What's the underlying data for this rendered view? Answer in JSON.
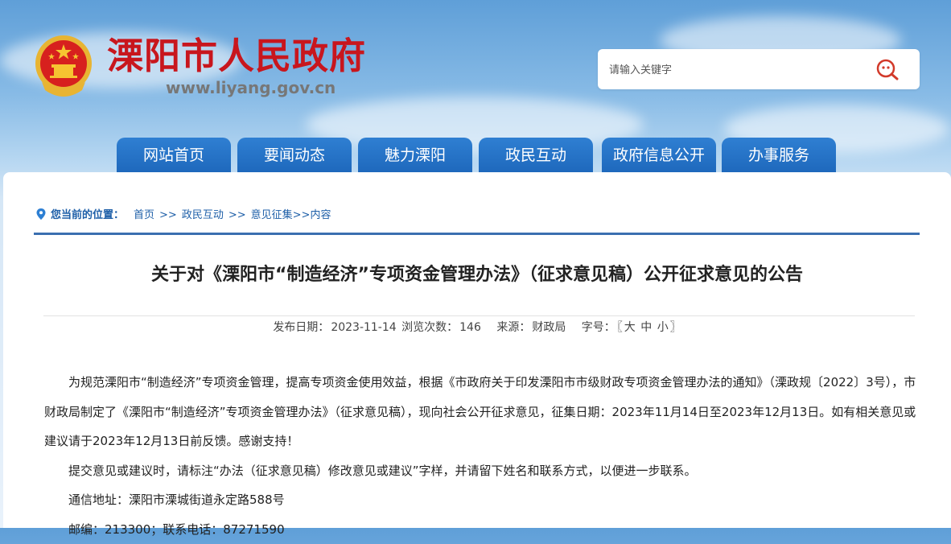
{
  "site": {
    "title": "溧阳市人民政府",
    "url": "www.liyang.gov.cn"
  },
  "search": {
    "placeholder": "请输入关键字",
    "icon": "search-icon"
  },
  "nav": {
    "items": [
      {
        "label": "网站首页"
      },
      {
        "label": "要闻动态"
      },
      {
        "label": "魅力溧阳"
      },
      {
        "label": "政民互动"
      },
      {
        "label": "政府信息公开"
      },
      {
        "label": "办事服务"
      }
    ]
  },
  "breadcrumb": {
    "label": "您当前的位置：",
    "items": [
      "首页",
      "政民互动",
      "意见征集"
    ],
    "separator": ">>",
    "current": ">>内容"
  },
  "article": {
    "title": "关于对《溧阳市“制造经济”专项资金管理办法》（征求意见稿）公开征求意见的公告",
    "meta": {
      "date_label": "发布日期：",
      "date": "2023-11-14",
      "views_label": "浏览次数：",
      "views": "146",
      "source_label": "来源：",
      "source": "财政局",
      "size_label": "字号：",
      "size_open": "〖",
      "size_large": "大",
      "size_medium": "中",
      "size_small": "小",
      "size_close": "〗"
    },
    "paragraphs": [
      "为规范溧阳市“制造经济”专项资金管理，提高专项资金使用效益，根据《市政府关于印发溧阳市市级财政专项资金管理办法的通知》（溧政规〔2022〕3号），市财政局制定了《溧阳市“制造经济”专项资金管理办法》（征求意见稿），现向社会公开征求意见，征集日期：2023年11月14日至2023年12月13日。如有相关意见或建议请于2023年12月13日前反馈。感谢支持！",
      "提交意见或建议时，请标注“办法（征求意见稿）修改意见或建议”字样，并请留下姓名和联系方式，以便进一步联系。",
      "通信地址：溧阳市溧城街道永定路588号",
      "邮编：213300；联系电话：87271590"
    ]
  },
  "colors": {
    "brand_red": "#c8161d",
    "nav_blue": "#1e68bc",
    "link_blue": "#1e5fa8"
  }
}
